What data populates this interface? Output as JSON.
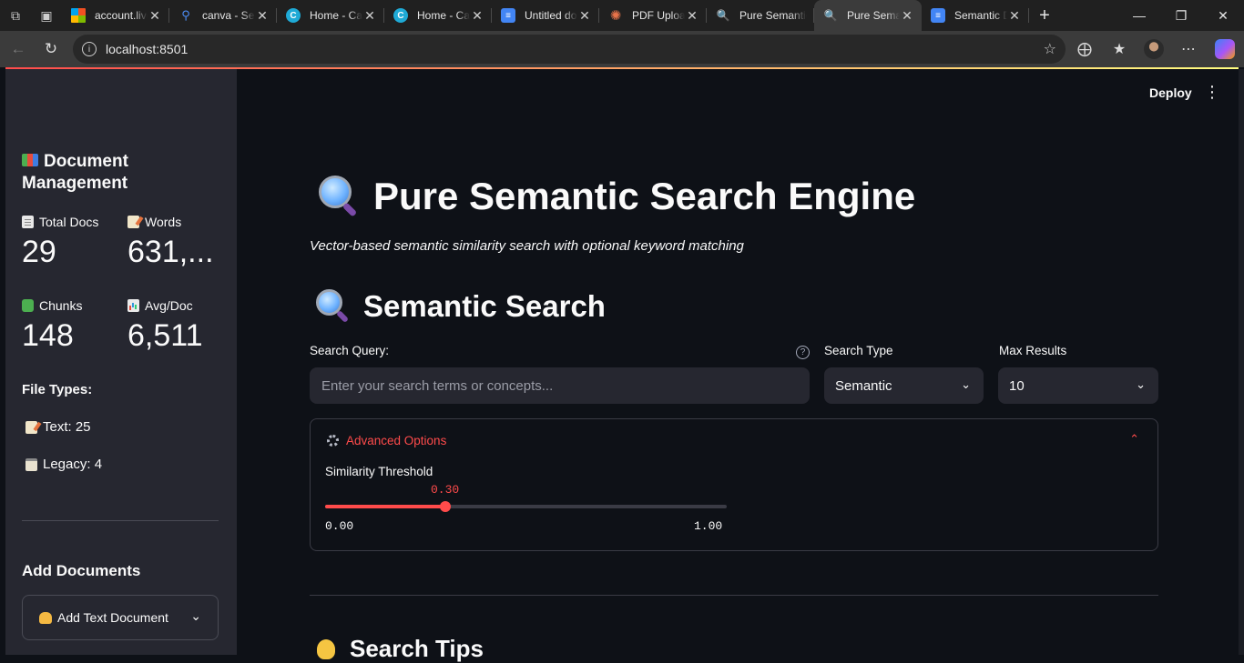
{
  "browser": {
    "tabs": [
      {
        "title": "account.live.com",
        "favicon": "microsoft-icon"
      },
      {
        "title": "canva - Search",
        "favicon": "search-icon"
      },
      {
        "title": "Home - Canva",
        "favicon": "canva-icon"
      },
      {
        "title": "Home - Canva",
        "favicon": "canva-icon"
      },
      {
        "title": "Untitled document",
        "favicon": "docs-icon"
      },
      {
        "title": "PDF Upload",
        "favicon": "burst-icon"
      },
      {
        "title": "Pure Semantic",
        "favicon": "magnifier-icon"
      },
      {
        "title": "Pure Semantic",
        "favicon": "magnifier-icon"
      },
      {
        "title": "Semantic Doc",
        "favicon": "docs-icon"
      }
    ],
    "url": "localhost:8501"
  },
  "sidebar": {
    "title": "Document Management",
    "metrics": [
      {
        "label": "Total Docs",
        "value": "29",
        "icon": "page-icon"
      },
      {
        "label": "Words",
        "value": "631,...",
        "icon": "memo-icon"
      },
      {
        "label": "Chunks",
        "value": "148",
        "icon": "puzzle-icon"
      },
      {
        "label": "Avg/Doc",
        "value": "6,511",
        "icon": "bar-chart-icon"
      }
    ],
    "file_types_title": "File Types:",
    "file_types": [
      {
        "label": "Text: 25",
        "icon": "memo-icon"
      },
      {
        "label": "Legacy: 4",
        "icon": "clipboard-icon"
      }
    ],
    "add_title": "Add Documents",
    "add_expander": "Add Text Document"
  },
  "header": {
    "deploy": "Deploy"
  },
  "main": {
    "title": "Pure Semantic Search Engine",
    "caption": "Vector-based semantic similarity search with optional keyword matching",
    "section_title": "Semantic Search",
    "query_label": "Search Query:",
    "query_placeholder": "Enter your search terms or concepts...",
    "search_type_label": "Search Type",
    "search_type_value": "Semantic",
    "max_results_label": "Max Results",
    "max_results_value": "10",
    "advanced_label": "Advanced Options",
    "slider_label": "Similarity Threshold",
    "slider_value": "0.30",
    "slider_fraction": 0.3,
    "slider_min": "0.00",
    "slider_max": "1.00",
    "tips_title": "Search Tips"
  },
  "colors": {
    "accent": "#ff4b4b",
    "background": "#0e1117",
    "sidebar": "#262730"
  }
}
